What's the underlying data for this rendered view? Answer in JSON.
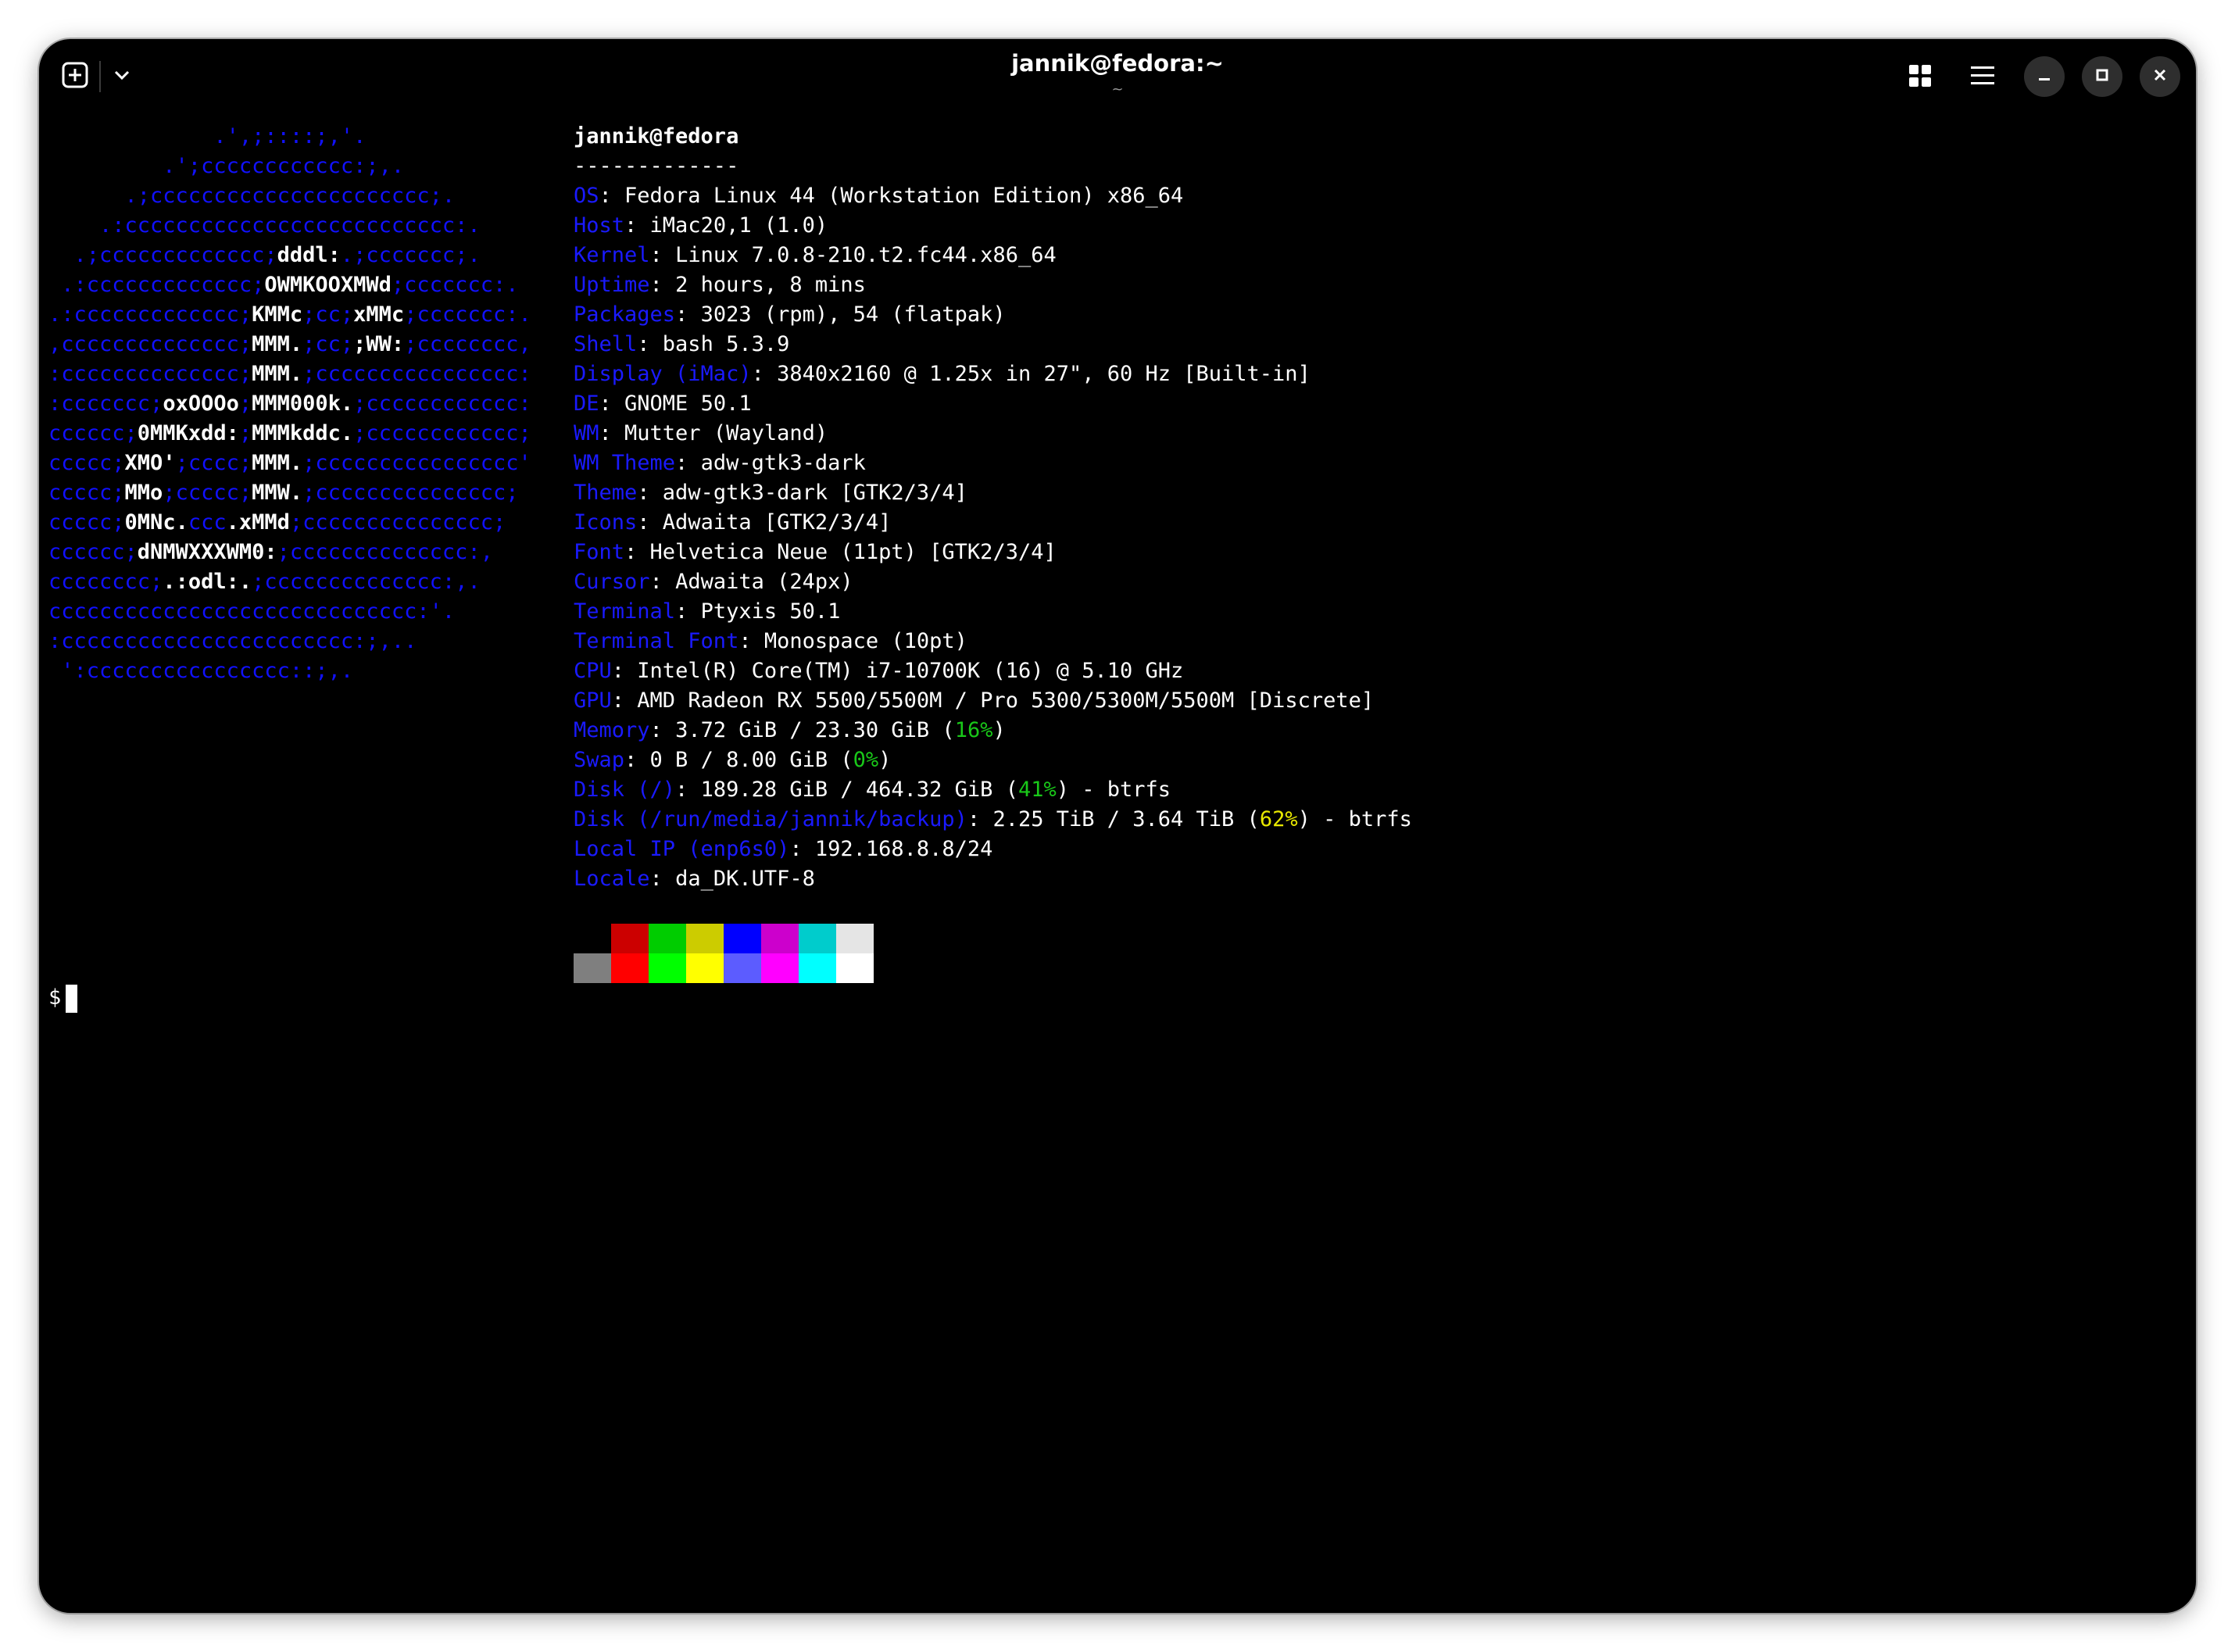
{
  "window": {
    "title": "jannik@fedora:~",
    "subtitle": "~"
  },
  "icons": {
    "new_tab": "new-tab-icon",
    "tab_menu": "chevron-down-icon",
    "overview": "grid-icon",
    "menu": "hamburger-menu-icon",
    "minimize": "minimize-icon",
    "maximize": "maximize-icon",
    "close": "close-icon"
  },
  "colors": {
    "terminal_bg": "#000000",
    "logo_blue": "#1111ff",
    "label_blue": "#1a1aff",
    "text": "#ffffff",
    "percent_green": "#19c819",
    "percent_yellow": "#e8e800"
  },
  "logo": [
    [
      "             .',;::::;,'.",
      ""
    ],
    [
      "         .';cccccccccccc:;,.",
      ""
    ],
    [
      "      .;cccccccccccccccccccccc;.",
      ""
    ],
    [
      "    .:cccccccccccccccccccccccccc:.",
      ""
    ],
    [
      "  .;ccccccccccccc;",
      "dddl:",
      ".;ccccccc;."
    ],
    [
      " .:ccccccccccccc;",
      "OWMKOOXMWd",
      ";ccccccc:."
    ],
    [
      ".:ccccccccccccc;",
      "KMMc",
      ";cc;",
      "xMMc",
      ";ccccccc:."
    ],
    [
      ",cccccccccccccc;",
      "MMM.",
      ";cc;",
      ";WW:",
      ";cccccccc,"
    ],
    [
      ":cccccccccccccc;",
      "MMM.",
      ";cccccccccccccccc:"
    ],
    [
      ":ccccccc;",
      "oxOOOo",
      ";",
      "MMM000k.",
      ";cccccccccccc:"
    ],
    [
      "cccccc;",
      "0MMKxdd:",
      ";",
      "MMMkddc.",
      ";cccccccccccc;"
    ],
    [
      "ccccc;",
      "XMO'",
      ";cccc;",
      "MMM.",
      ";cccccccccccccccc'"
    ],
    [
      "ccccc;",
      "MMo",
      ";ccccc;",
      "MMW.",
      ";ccccccccccccccc;"
    ],
    [
      "ccccc;",
      "0MNc.",
      "ccc",
      ".xMMd",
      ";ccccccccccccccc;"
    ],
    [
      "cccccc;",
      "dNMWXXXWM0:",
      ";cccccccccccccc:,"
    ],
    [
      "cccccccc;",
      ".:odl:.",
      ";cccccccccccccc:,."
    ],
    [
      "ccccccccccccccccccccccccccccc:'.",
      ""
    ],
    [
      ":ccccccccccccccccccccccc:;,..",
      ""
    ],
    [
      " ':cccccccccccccccc::;,.",
      ""
    ]
  ],
  "user_host": "jannik@fedora",
  "separator": "-------------",
  "info": [
    {
      "label": "OS",
      "value": "Fedora Linux 44 (Workstation Edition) x86_64"
    },
    {
      "label": "Host",
      "value": "iMac20,1 (1.0)"
    },
    {
      "label": "Kernel",
      "value": "Linux 7.0.8-210.t2.fc44.x86_64"
    },
    {
      "label": "Uptime",
      "value": "2 hours, 8 mins"
    },
    {
      "label": "Packages",
      "value": "3023 (rpm), 54 (flatpak)"
    },
    {
      "label": "Shell",
      "value": "bash 5.3.9"
    },
    {
      "label": "Display (iMac)",
      "value": "3840x2160 @ 1.25x in 27\", 60 Hz [Built-in]"
    },
    {
      "label": "DE",
      "value": "GNOME 50.1"
    },
    {
      "label": "WM",
      "value": "Mutter (Wayland)"
    },
    {
      "label": "WM Theme",
      "value": "adw-gtk3-dark"
    },
    {
      "label": "Theme",
      "value": "adw-gtk3-dark [GTK2/3/4]"
    },
    {
      "label": "Icons",
      "value": "Adwaita [GTK2/3/4]"
    },
    {
      "label": "Font",
      "value": "Helvetica Neue (11pt) [GTK2/3/4]"
    },
    {
      "label": "Cursor",
      "value": "Adwaita (24px)"
    },
    {
      "label": "Terminal",
      "value": "Ptyxis 50.1"
    },
    {
      "label": "Terminal Font",
      "value": "Monospace (10pt)"
    },
    {
      "label": "CPU",
      "value": "Intel(R) Core(TM) i7-10700K (16) @ 5.10 GHz"
    },
    {
      "label": "GPU",
      "value": "AMD Radeon RX 5500/5500M / Pro 5300/5300M/5500M [Discrete]"
    },
    {
      "label": "Memory",
      "value": "3.72 GiB / 23.30 GiB (",
      "pct": "16%",
      "pct_color": "#19c819",
      "suffix": ")"
    },
    {
      "label": "Swap",
      "value": "0 B / 8.00 GiB (",
      "pct": "0%",
      "pct_color": "#19c819",
      "suffix": ")"
    },
    {
      "label": "Disk (/)",
      "value": "189.28 GiB / 464.32 GiB (",
      "pct": "41%",
      "pct_color": "#19c819",
      "suffix": ") - btrfs"
    },
    {
      "label": "Disk (/run/media/jannik/backup)",
      "value": "2.25 TiB / 3.64 TiB (",
      "pct": "62%",
      "pct_color": "#e8e800",
      "suffix": ") - btrfs"
    },
    {
      "label": "Local IP (enp6s0)",
      "value": "192.168.8.8/24"
    },
    {
      "label": "Locale",
      "value": "da_DK.UTF-8"
    }
  ],
  "palette": {
    "row1": [
      "#000000",
      "#cc0000",
      "#00cc00",
      "#cccc00",
      "#0000ff",
      "#cc00cc",
      "#00cccc",
      "#e5e5e5"
    ],
    "row2": [
      "#7f7f7f",
      "#ff0000",
      "#00ff00",
      "#ffff00",
      "#5c5cff",
      "#ff00ff",
      "#00ffff",
      "#ffffff"
    ]
  },
  "prompt": "$"
}
